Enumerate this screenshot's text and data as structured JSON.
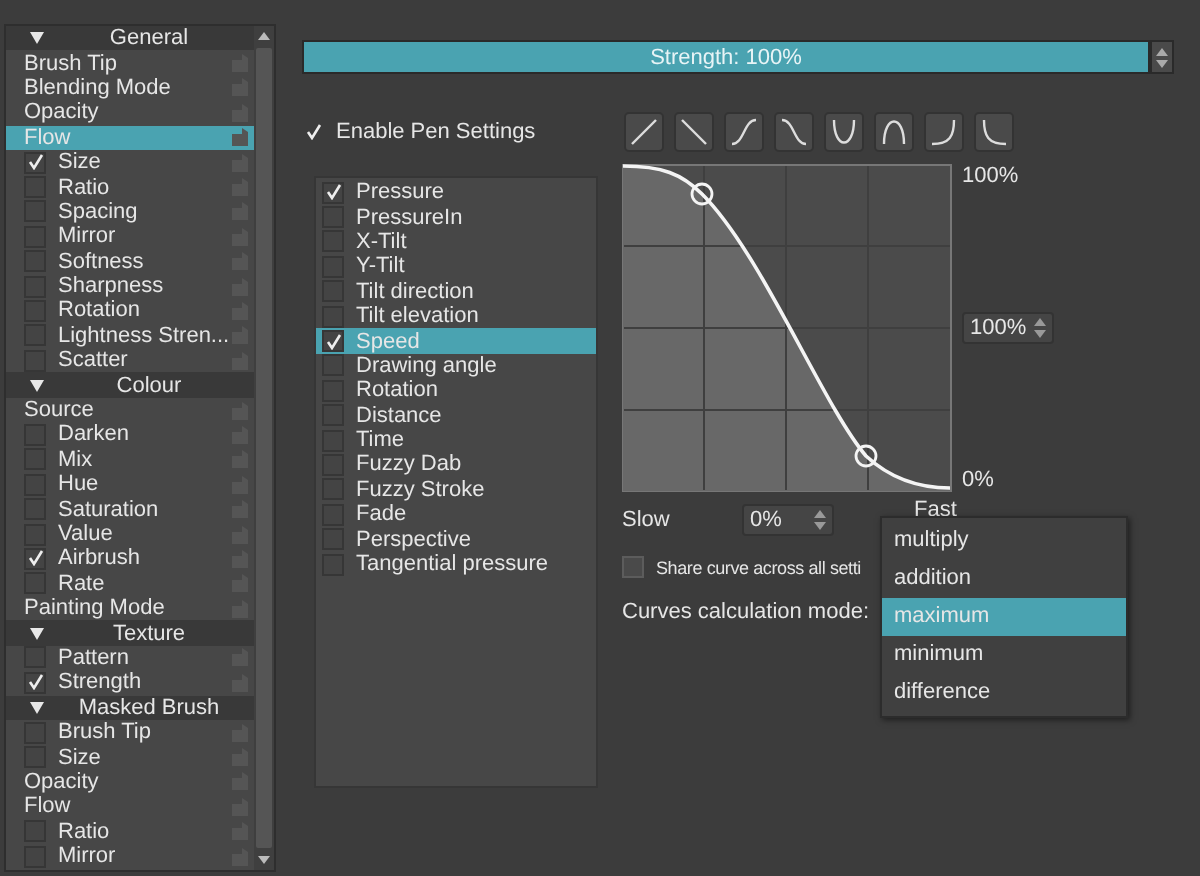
{
  "options_panel": {
    "items": [
      {
        "kind": "header",
        "label": "General",
        "selected": false
      },
      {
        "kind": "plain",
        "label": "Brush Tip",
        "selected": false
      },
      {
        "kind": "plain",
        "label": "Blending Mode",
        "selected": false
      },
      {
        "kind": "plain",
        "label": "Opacity",
        "selected": false
      },
      {
        "kind": "plain",
        "label": "Flow",
        "selected": true
      },
      {
        "kind": "check",
        "label": "Size",
        "checked": true,
        "selected": false
      },
      {
        "kind": "check",
        "label": "Ratio",
        "checked": false,
        "selected": false
      },
      {
        "kind": "check",
        "label": "Spacing",
        "checked": false,
        "selected": false
      },
      {
        "kind": "check",
        "label": "Mirror",
        "checked": false,
        "selected": false
      },
      {
        "kind": "check",
        "label": "Softness",
        "checked": false,
        "selected": false
      },
      {
        "kind": "check",
        "label": "Sharpness",
        "checked": false,
        "selected": false
      },
      {
        "kind": "check",
        "label": "Rotation",
        "checked": false,
        "selected": false
      },
      {
        "kind": "check",
        "label": "Lightness Stren...",
        "checked": false,
        "selected": false
      },
      {
        "kind": "check",
        "label": "Scatter",
        "checked": false,
        "selected": false
      },
      {
        "kind": "header",
        "label": "Colour",
        "selected": false
      },
      {
        "kind": "plain",
        "label": "Source",
        "selected": false
      },
      {
        "kind": "check",
        "label": "Darken",
        "checked": false,
        "selected": false
      },
      {
        "kind": "check",
        "label": "Mix",
        "checked": false,
        "selected": false
      },
      {
        "kind": "check",
        "label": "Hue",
        "checked": false,
        "selected": false
      },
      {
        "kind": "check",
        "label": "Saturation",
        "checked": false,
        "selected": false
      },
      {
        "kind": "check",
        "label": "Value",
        "checked": false,
        "selected": false
      },
      {
        "kind": "check",
        "label": "Airbrush",
        "checked": true,
        "selected": false
      },
      {
        "kind": "check",
        "label": "Rate",
        "checked": false,
        "selected": false
      },
      {
        "kind": "plain",
        "label": "Painting Mode",
        "selected": false
      },
      {
        "kind": "header",
        "label": "Texture",
        "selected": false
      },
      {
        "kind": "check",
        "label": "Pattern",
        "checked": false,
        "selected": false
      },
      {
        "kind": "check",
        "label": "Strength",
        "checked": true,
        "selected": false
      },
      {
        "kind": "header",
        "label": "Masked Brush",
        "selected": false
      },
      {
        "kind": "check",
        "label": "Brush Tip",
        "checked": false,
        "selected": false
      },
      {
        "kind": "check",
        "label": "Size",
        "checked": false,
        "selected": false
      },
      {
        "kind": "plain",
        "label": "Opacity",
        "selected": false
      },
      {
        "kind": "plain",
        "label": "Flow",
        "selected": false
      },
      {
        "kind": "check",
        "label": "Ratio",
        "checked": false,
        "selected": false
      },
      {
        "kind": "check",
        "label": "Mirror",
        "checked": false,
        "selected": false
      }
    ]
  },
  "strength_slider": {
    "label": "Strength: 100%",
    "level": 1
  },
  "enable_pen_settings": {
    "label": "Enable Pen Settings",
    "checked": true
  },
  "sensors": [
    {
      "label": "Pressure",
      "checked": true,
      "selected": false
    },
    {
      "label": "PressureIn",
      "checked": false,
      "selected": false
    },
    {
      "label": "X-Tilt",
      "checked": false,
      "selected": false
    },
    {
      "label": "Y-Tilt",
      "checked": false,
      "selected": false
    },
    {
      "label": "Tilt direction",
      "checked": false,
      "selected": false
    },
    {
      "label": "Tilt elevation",
      "checked": false,
      "selected": false
    },
    {
      "label": "Speed",
      "checked": true,
      "selected": true
    },
    {
      "label": "Drawing angle",
      "checked": false,
      "selected": false
    },
    {
      "label": "Rotation",
      "checked": false,
      "selected": false
    },
    {
      "label": "Distance",
      "checked": false,
      "selected": false
    },
    {
      "label": "Time",
      "checked": false,
      "selected": false
    },
    {
      "label": "Fuzzy Dab",
      "checked": false,
      "selected": false
    },
    {
      "label": "Fuzzy Stroke",
      "checked": false,
      "selected": false
    },
    {
      "label": "Fade",
      "checked": false,
      "selected": false
    },
    {
      "label": "Perspective",
      "checked": false,
      "selected": false
    },
    {
      "label": "Tangential pressure",
      "checked": false,
      "selected": false
    }
  ],
  "curve": {
    "top_label": "100%",
    "bottom_label": "0%",
    "max_value": "100%",
    "min_label": "Slow",
    "min_value": "0%",
    "max_label": "Fast"
  },
  "share_curve": {
    "label": "Share curve across all setti",
    "checked": false
  },
  "curves_mode": {
    "label": "Curves calculation mode:",
    "options": [
      {
        "label": "multiply",
        "selected": false
      },
      {
        "label": "addition",
        "selected": false
      },
      {
        "label": "maximum",
        "selected": true
      },
      {
        "label": "minimum",
        "selected": false
      },
      {
        "label": "difference",
        "selected": false
      }
    ]
  }
}
